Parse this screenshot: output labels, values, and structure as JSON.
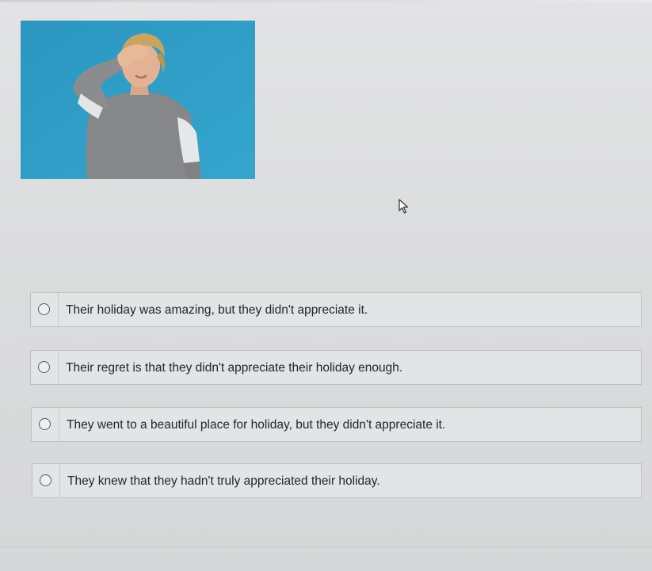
{
  "question": {
    "image_icon": "photo-person-facepalm",
    "options": [
      {
        "label": "Their holiday was amazing, but they didn't appreciate it.",
        "selected": false
      },
      {
        "label": "Their regret is that they didn't appreciate their holiday enough.",
        "selected": false
      },
      {
        "label": "They went to a beautiful place for holiday, but they didn't appreciate it.",
        "selected": false
      },
      {
        "label": "They knew that they hadn't truly appreciated their holiday.",
        "selected": false
      }
    ]
  },
  "cursor_icon": "mouse-pointer-icon",
  "colors": {
    "photo_background": "#2e9dc6",
    "page_background": "#dcddde"
  }
}
